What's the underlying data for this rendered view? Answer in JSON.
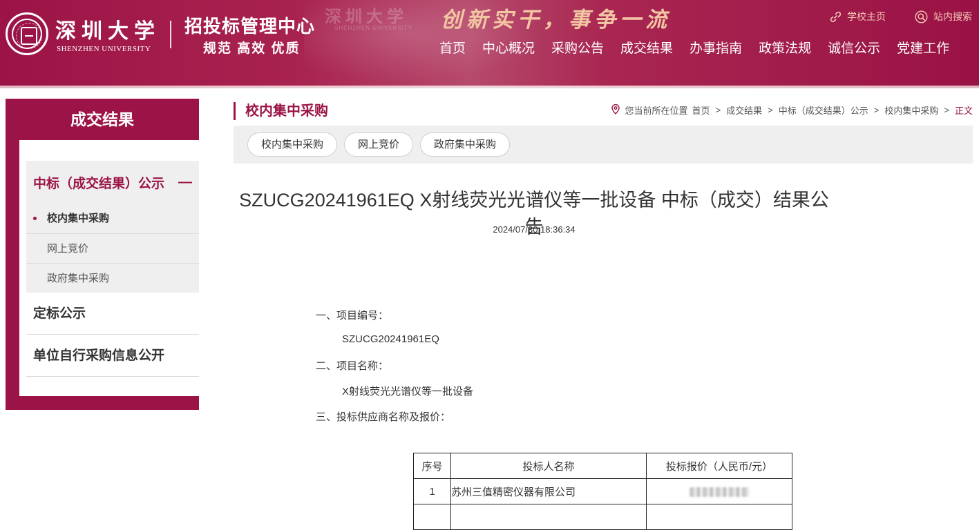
{
  "header": {
    "university_cn": "深圳大学",
    "university_en": "SHENZHEN UNIVERSITY",
    "center_name": "招投标管理中心",
    "motto": "规范 高效 优质",
    "slogan": "创新实干，事争一流",
    "watermark": "深圳大学",
    "watermark_en": "SHENZHEN UNIVERSITY",
    "top_links": [
      {
        "label": "学校主页",
        "icon": "link-icon"
      },
      {
        "label": "站内搜索",
        "icon": "search-icon"
      }
    ],
    "nav": [
      "首页",
      "中心概况",
      "采购公告",
      "成交结果",
      "办事指南",
      "政策法规",
      "诚信公示",
      "党建工作"
    ],
    "colors": {
      "brand": "#9c1447",
      "slogan": "#f3c6a3",
      "top_link": "#f4c9b6"
    }
  },
  "sidebar": {
    "title": "成交结果",
    "group": {
      "label": "中标（成交结果）公示",
      "collapse_symbol": "—",
      "items": [
        "校内集中采购",
        "网上竞价",
        "政府集中采购"
      ]
    },
    "items": [
      "定标公示",
      "单位自行采购信息公开"
    ]
  },
  "main": {
    "section_title": "校内集中采购",
    "breadcrumb": {
      "prefix": "您当前所在位置",
      "items": [
        "首页",
        "成交结果",
        "中标（成交结果）公示",
        "校内集中采购",
        "正文"
      ],
      "separator": ">"
    },
    "tabs": [
      "校内集中采购",
      "网上竞价",
      "政府集中采购"
    ]
  },
  "article": {
    "title": "SZUCG20241961EQ X射线荧光光谱仪等一批设备 中标（成交）结果公告",
    "date": "2024/07/30 18:36:34",
    "section1_label": "一、项目编号：",
    "project_no": "SZUCG20241961EQ",
    "section2_label": "二、项目名称：",
    "project_name": "X射线荧光光谱仪等一批设备",
    "section3_label": "三、投标供应商名称及报价：",
    "table": {
      "headers": [
        "序号",
        "投标人名称",
        "投标报价（人民币/元）"
      ],
      "rows": [
        {
          "no": "1",
          "name": "苏州三值精密仪器有限公司",
          "price_redacted": true
        }
      ]
    }
  }
}
